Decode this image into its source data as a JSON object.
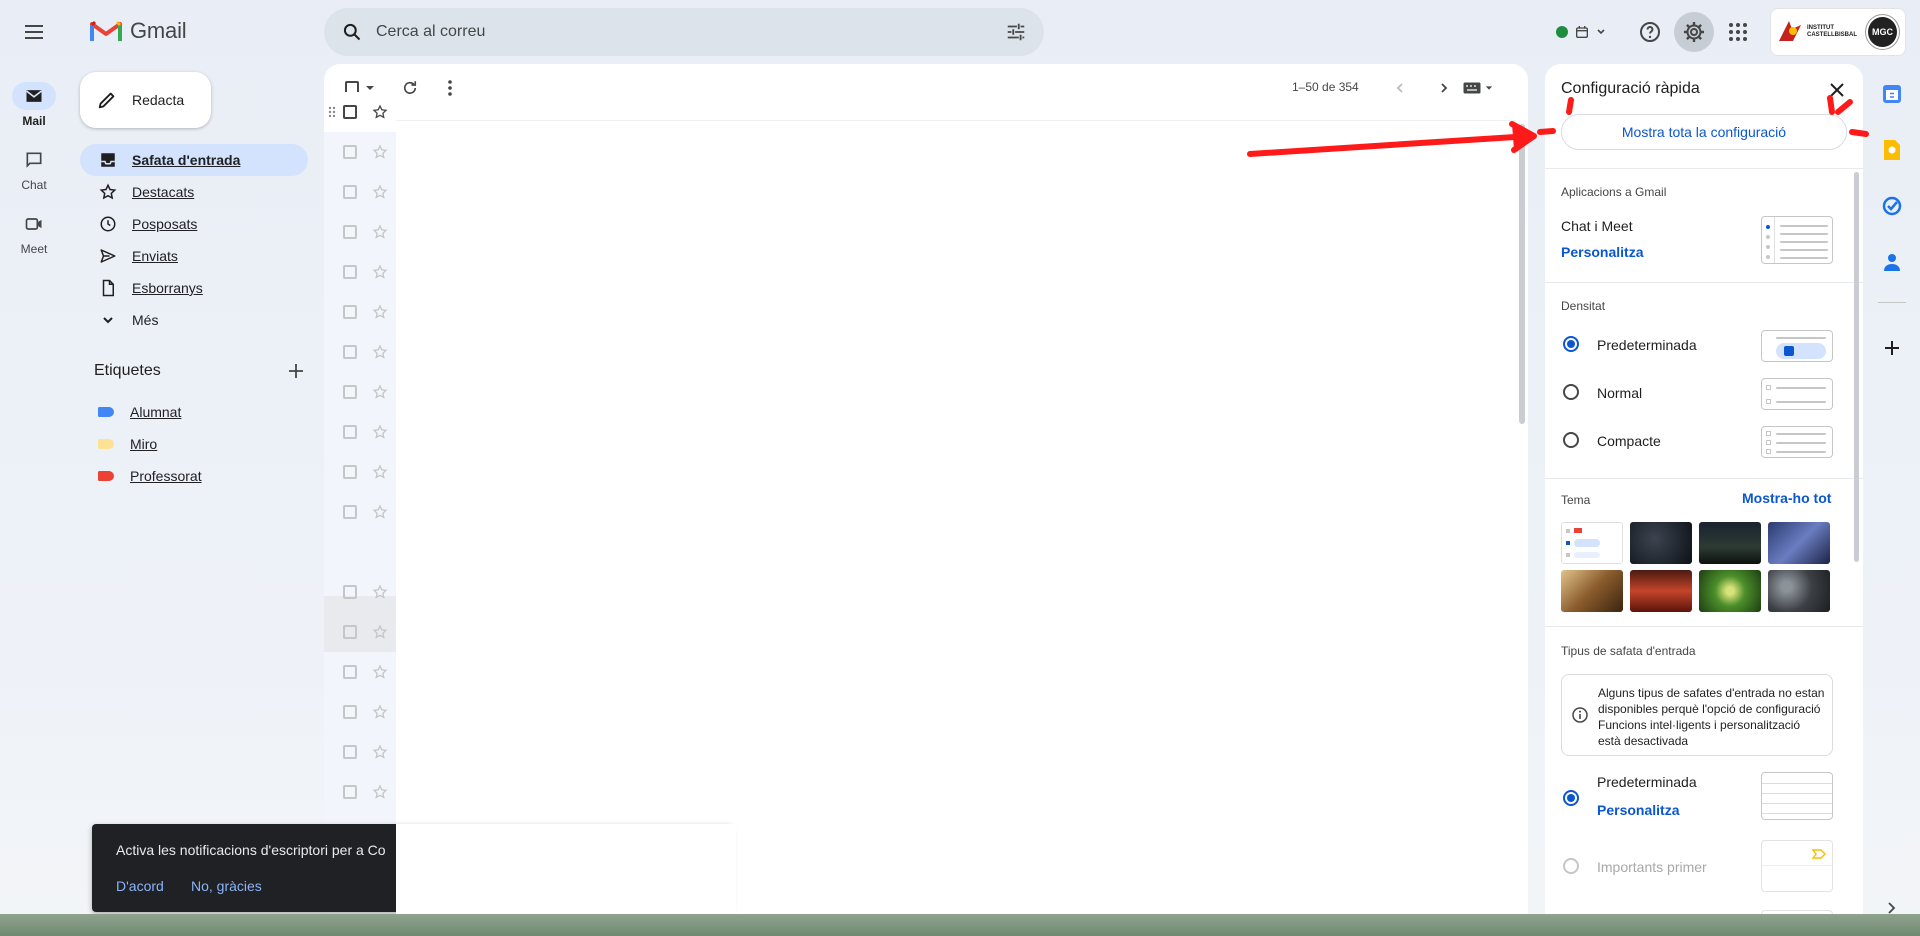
{
  "app": {
    "name": "Gmail"
  },
  "rail": {
    "items": [
      {
        "label": "Mail",
        "icon": "mail-icon",
        "active": true
      },
      {
        "label": "Chat",
        "icon": "chat-icon",
        "active": false
      },
      {
        "label": "Meet",
        "icon": "meet-icon",
        "active": false
      }
    ]
  },
  "search": {
    "placeholder": "Cerca al correu"
  },
  "compose": {
    "label": "Redacta"
  },
  "nav": {
    "items": [
      {
        "label": "Safata d'entrada",
        "icon": "inbox-icon"
      },
      {
        "label": "Destacats",
        "icon": "star-icon"
      },
      {
        "label": "Posposats",
        "icon": "clock-icon"
      },
      {
        "label": "Enviats",
        "icon": "send-icon"
      },
      {
        "label": "Esborranys",
        "icon": "draft-icon"
      },
      {
        "label": "Més",
        "icon": "chevron-down-icon"
      }
    ]
  },
  "labels": {
    "title": "Etiquetes",
    "items": [
      {
        "label": "Alumnat",
        "color": "#4285f4"
      },
      {
        "label": "Miro",
        "color": "#fde293"
      },
      {
        "label": "Professorat",
        "color": "#ea4335"
      }
    ]
  },
  "toolbar": {
    "pager": "1–50 de 354"
  },
  "toast": {
    "text": "Activa les notificacions d'escriptori per a Co",
    "ok": "D'acord",
    "no": "No, gràcies"
  },
  "quick_settings": {
    "title": "Configuració ràpida",
    "show_all": "Mostra tota la configuració",
    "apps_heading": "Aplicacions a Gmail",
    "chat_meet": "Chat i Meet",
    "customize": "Personalitza",
    "density_heading": "Densitat",
    "density_options": [
      {
        "label": "Predeterminada",
        "selected": true
      },
      {
        "label": "Normal",
        "selected": false
      },
      {
        "label": "Compacte",
        "selected": false
      }
    ],
    "theme_heading": "Tema",
    "theme_show_all": "Mostra-ho tot",
    "inbox_type_heading": "Tipus de safata d'entrada",
    "inbox_info": "Alguns tipus de safates d'entrada no estan disponibles perquè l'opció de configuració Funcions intel·ligents i personalització està desactivada",
    "inbox_default": "Predeterminada",
    "inbox_customize": "Personalitza",
    "inbox_important": "Importants primer"
  },
  "account": {
    "inst_line1": "INSTITUT",
    "inst_line2": "CASTELLBISBAL",
    "badge": "MGC"
  },
  "colors": {
    "accent": "#0b57d0",
    "active_nav": "#d3e3fd",
    "annotation": "#ff1a1a"
  }
}
